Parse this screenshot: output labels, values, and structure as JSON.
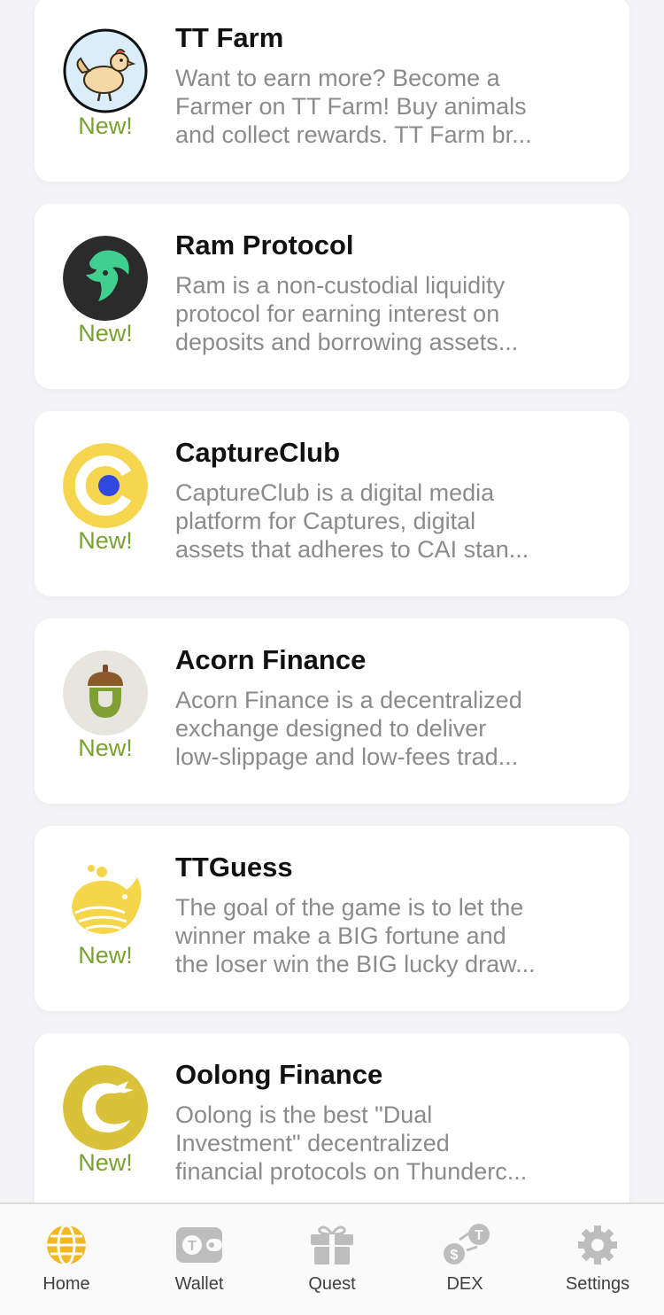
{
  "new_badge": "New!",
  "cards": [
    {
      "title": "TT Farm",
      "lines": [
        "Want to earn more? Become a",
        "Farmer on TT Farm! Buy animals",
        "and collect rewards. TT Farm br..."
      ]
    },
    {
      "title": "Ram Protocol",
      "lines": [
        "Ram is a non-custodial liquidity",
        "protocol for earning interest on",
        "deposits and borrowing assets..."
      ]
    },
    {
      "title": "CaptureClub",
      "lines": [
        "CaptureClub is a digital media",
        "platform for Captures, digital",
        "assets that adheres to CAI stan..."
      ]
    },
    {
      "title": "Acorn Finance",
      "lines": [
        "Acorn Finance is a decentralized",
        "exchange designed to deliver",
        "low-slippage and low-fees trad..."
      ]
    },
    {
      "title": "TTGuess",
      "lines": [
        "The goal of the game is to let the",
        "winner make a BIG fortune and",
        "the loser win the BIG lucky draw..."
      ]
    },
    {
      "title": "Oolong Finance",
      "lines": [
        "Oolong is the best \"Dual",
        "Investment\" decentralized",
        "financial protocols on Thunderc..."
      ]
    }
  ],
  "tabs": [
    {
      "label": "Home",
      "icon": "globe-icon",
      "active": true
    },
    {
      "label": "Wallet",
      "icon": "wallet-icon",
      "active": false
    },
    {
      "label": "Quest",
      "icon": "gift-icon",
      "active": false
    },
    {
      "label": "DEX",
      "icon": "exchange-icon",
      "active": false
    },
    {
      "label": "Settings",
      "icon": "gear-icon",
      "active": false
    }
  ],
  "colors": {
    "accent": "#f2b824",
    "new_badge": "#78a22f",
    "inactive_icon": "#bdbdbd"
  }
}
